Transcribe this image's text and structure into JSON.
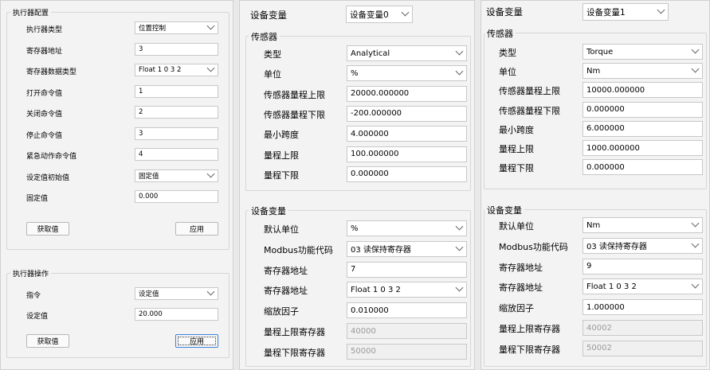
{
  "panel1": {
    "group_title": "执行器配置",
    "rows": [
      {
        "label": "执行器类型",
        "value": "位置控制",
        "type": "combo"
      },
      {
        "label": "寄存器地址",
        "value": "3",
        "type": "input"
      },
      {
        "label": "寄存器数据类型",
        "value": "Float 1 0 3 2",
        "type": "combo"
      },
      {
        "label": "打开命令值",
        "value": "1",
        "type": "input"
      },
      {
        "label": "关闭命令值",
        "value": "2",
        "type": "input"
      },
      {
        "label": "停止命令值",
        "value": "3",
        "type": "input"
      },
      {
        "label": "紧急动作命令值",
        "value": "4",
        "type": "input"
      },
      {
        "label": "设定值初始值",
        "value": "固定值",
        "type": "combo"
      },
      {
        "label": "固定值",
        "value": "0.000",
        "type": "input"
      }
    ],
    "get_button": "获取值",
    "apply_button": "应用",
    "op_group_title": "执行器操作",
    "op_rows": [
      {
        "label": "指令",
        "value": "设定值",
        "type": "combo"
      },
      {
        "label": "设定值",
        "value": "20.000",
        "type": "input"
      }
    ],
    "op_get_button": "获取值",
    "op_apply_button": "应用"
  },
  "panel2": {
    "device_label": "设备变量",
    "device_value": "设备变量0",
    "sensor_title": "传感器",
    "sensor_rows": [
      {
        "label": "类型",
        "value": "Analytical",
        "type": "combo"
      },
      {
        "label": "单位",
        "value": "%",
        "type": "combo"
      },
      {
        "label": "传感器量程上限",
        "value": "20000.000000",
        "type": "input"
      },
      {
        "label": "传感器量程下限",
        "value": "-200.000000",
        "type": "input"
      },
      {
        "label": "最小跨度",
        "value": "4.000000",
        "type": "input"
      },
      {
        "label": "量程上限",
        "value": "100.000000",
        "type": "input"
      },
      {
        "label": "量程下限",
        "value": "0.000000",
        "type": "input"
      }
    ],
    "var_title": "设备变量",
    "var_rows": [
      {
        "label": "默认单位",
        "value": "%",
        "type": "combo"
      },
      {
        "label": "Modbus功能代码",
        "value": "03 读保持寄存器",
        "type": "combo"
      },
      {
        "label": "寄存器地址",
        "value": "7",
        "type": "input"
      },
      {
        "label": "寄存器地址",
        "value": "Float 1 0 3 2",
        "type": "combo"
      },
      {
        "label": "缩放因子",
        "value": "0.010000",
        "type": "input"
      },
      {
        "label": "量程上限寄存器",
        "value": "40000",
        "type": "disabled"
      },
      {
        "label": "量程下限寄存器",
        "value": "50000",
        "type": "disabled"
      }
    ]
  },
  "panel3": {
    "device_label": "设备变量",
    "device_value": "设备变量1",
    "sensor_title": "传感器",
    "sensor_rows": [
      {
        "label": "类型",
        "value": "Torque",
        "type": "combo"
      },
      {
        "label": "单位",
        "value": "Nm",
        "type": "combo"
      },
      {
        "label": "传感器量程上限",
        "value": "10000.000000",
        "type": "input"
      },
      {
        "label": "传感器量程下限",
        "value": "0.000000",
        "type": "input"
      },
      {
        "label": "最小跨度",
        "value": "6.000000",
        "type": "input"
      },
      {
        "label": "量程上限",
        "value": "1000.000000",
        "type": "input"
      },
      {
        "label": "量程下限",
        "value": "0.000000",
        "type": "input"
      }
    ],
    "var_title": "设备变量",
    "var_rows": [
      {
        "label": "默认单位",
        "value": "Nm",
        "type": "combo"
      },
      {
        "label": "Modbus功能代码",
        "value": "03 读保持寄存器",
        "type": "combo"
      },
      {
        "label": "寄存器地址",
        "value": "9",
        "type": "input"
      },
      {
        "label": "寄存器地址",
        "value": "Float 1 0 3 2",
        "type": "combo"
      },
      {
        "label": "缩放因子",
        "value": "1.000000",
        "type": "input"
      },
      {
        "label": "量程上限寄存器",
        "value": "40002",
        "type": "disabled"
      },
      {
        "label": "量程下限寄存器",
        "value": "50002",
        "type": "disabled"
      }
    ]
  }
}
